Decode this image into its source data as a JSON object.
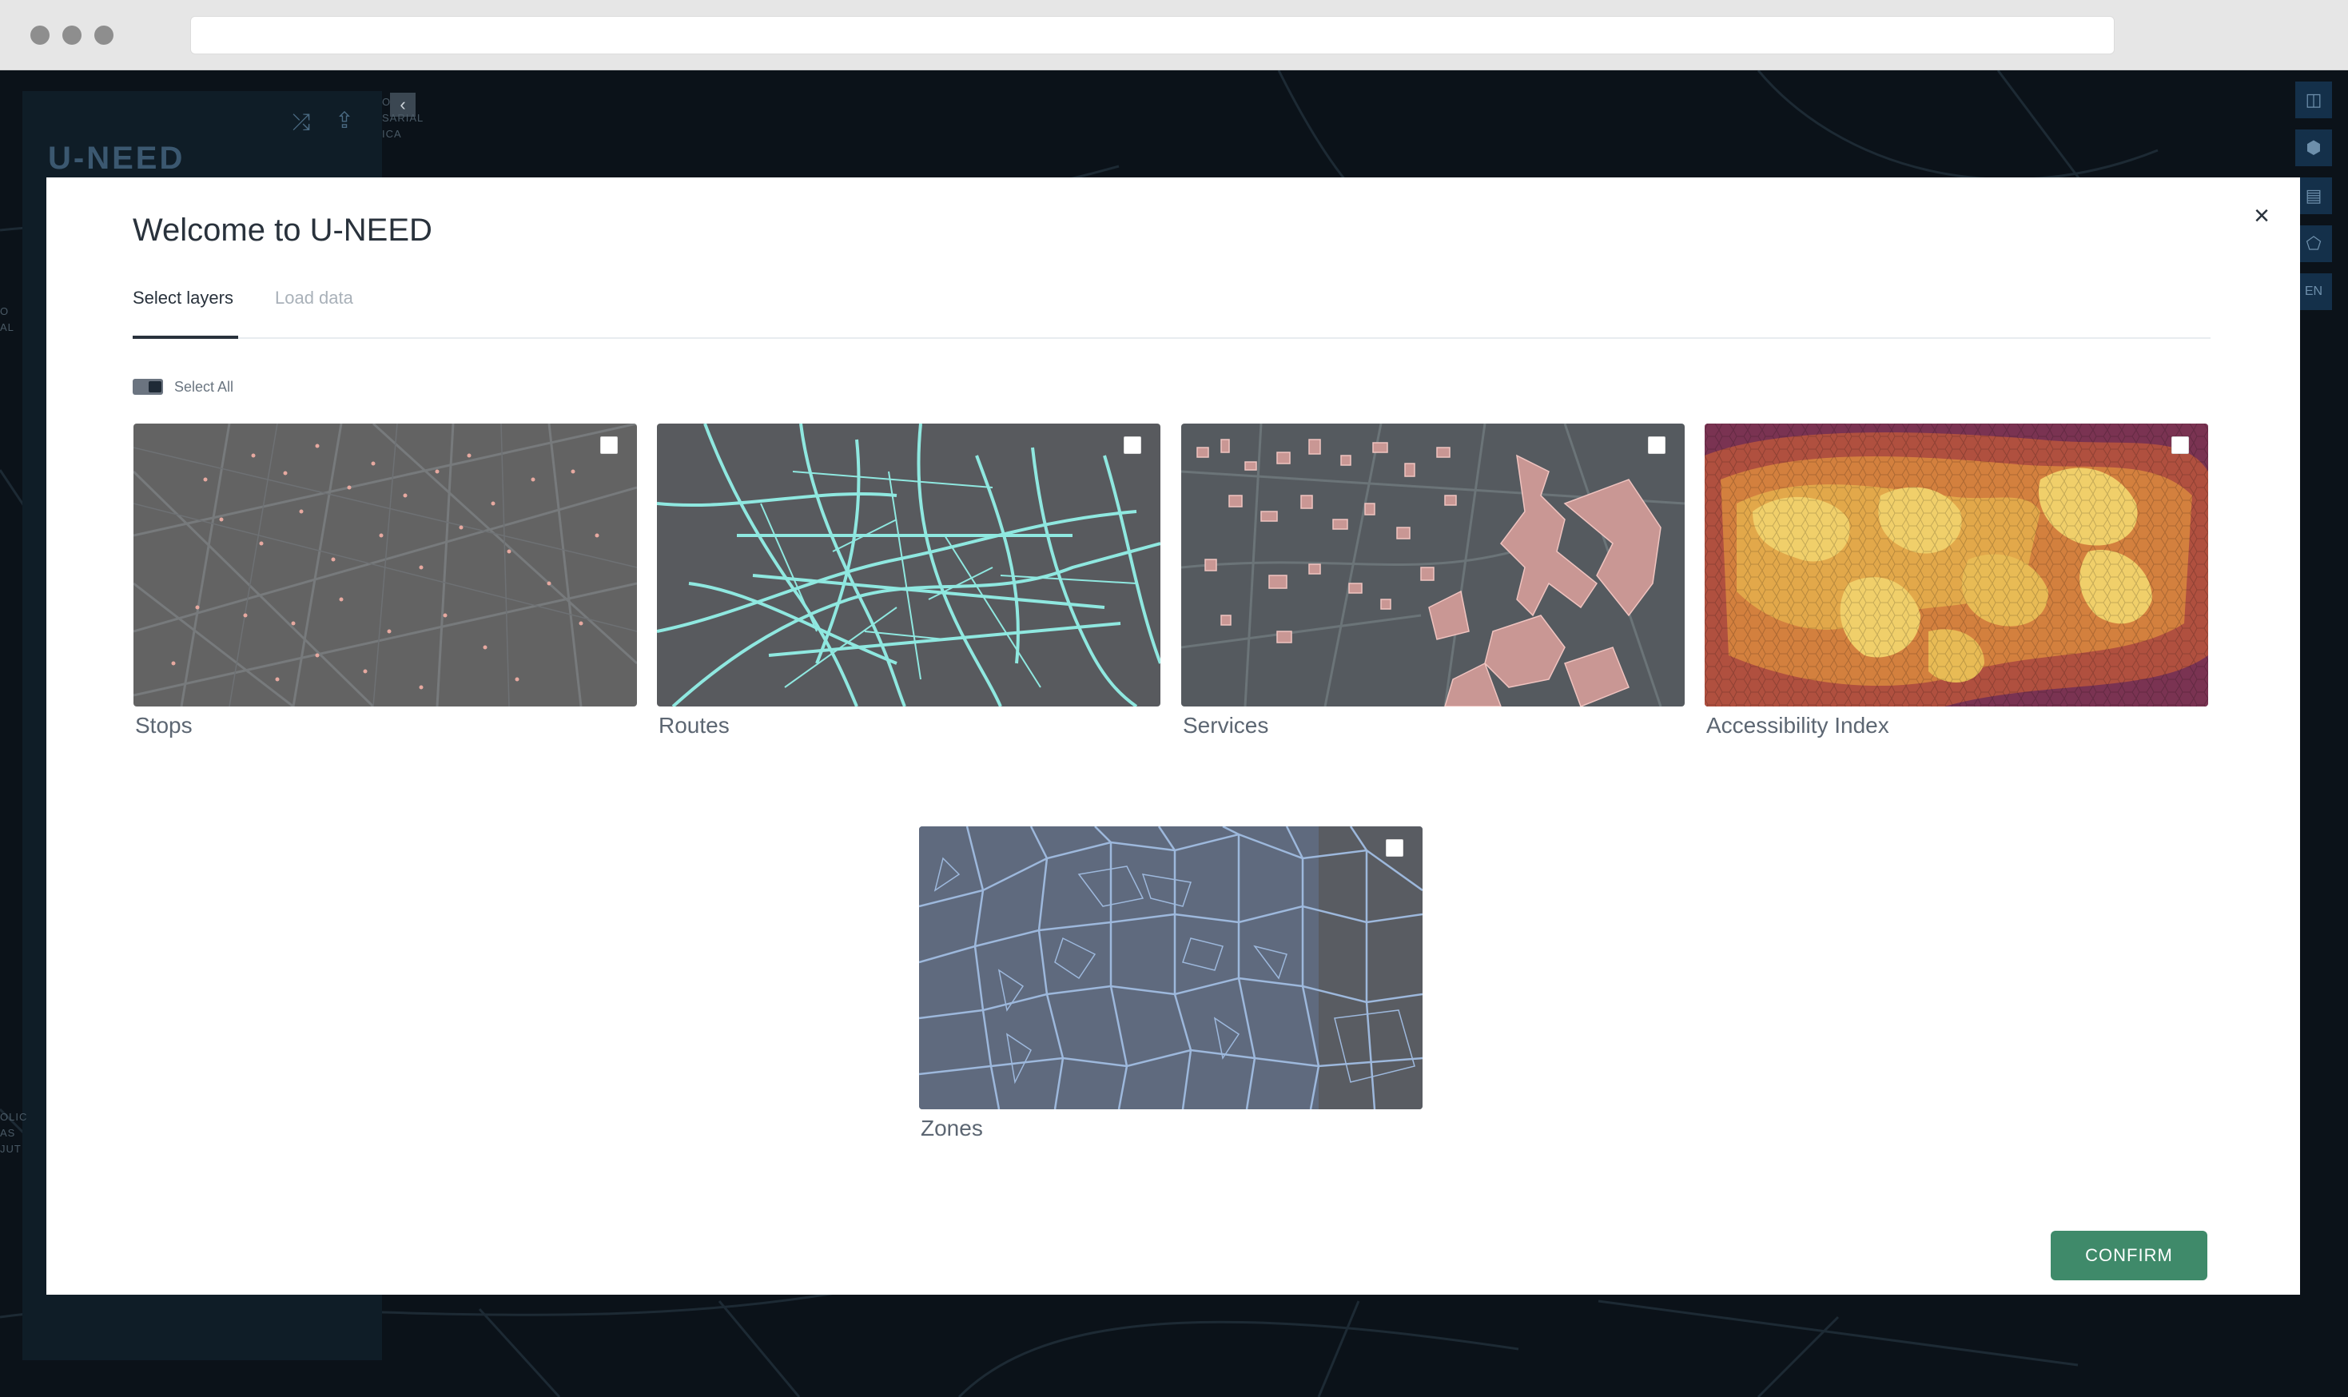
{
  "app": {
    "brand": "U-NEED",
    "language": "EN"
  },
  "map_fragments": {
    "top": [
      "O",
      "SARIAL",
      "ICA"
    ],
    "left_mid": [
      "O",
      "AL"
    ],
    "left_bottom": [
      "OLIC",
      "AS",
      "JUT"
    ]
  },
  "modal": {
    "title": "Welcome to U-NEED",
    "close_label": "×",
    "tabs": [
      {
        "label": "Select layers",
        "active": true
      },
      {
        "label": "Load data",
        "active": false
      }
    ],
    "select_all_label": "Select All",
    "layers": [
      {
        "label": "Stops",
        "checked": false
      },
      {
        "label": "Routes",
        "checked": false
      },
      {
        "label": "Services",
        "checked": false
      },
      {
        "label": "Accessibility Index",
        "checked": false
      },
      {
        "label": "Zones",
        "checked": false
      }
    ],
    "confirm_label": "CONFIRM"
  },
  "colors": {
    "accent_green": "#3f8a6a",
    "routes": "#8fe8e0",
    "stops": "#e7a9a0",
    "services": "#e8b0ab",
    "zones": "#9db8dc",
    "accessibility_low": "#8a3b58",
    "accessibility_high": "#f0cf6a"
  }
}
